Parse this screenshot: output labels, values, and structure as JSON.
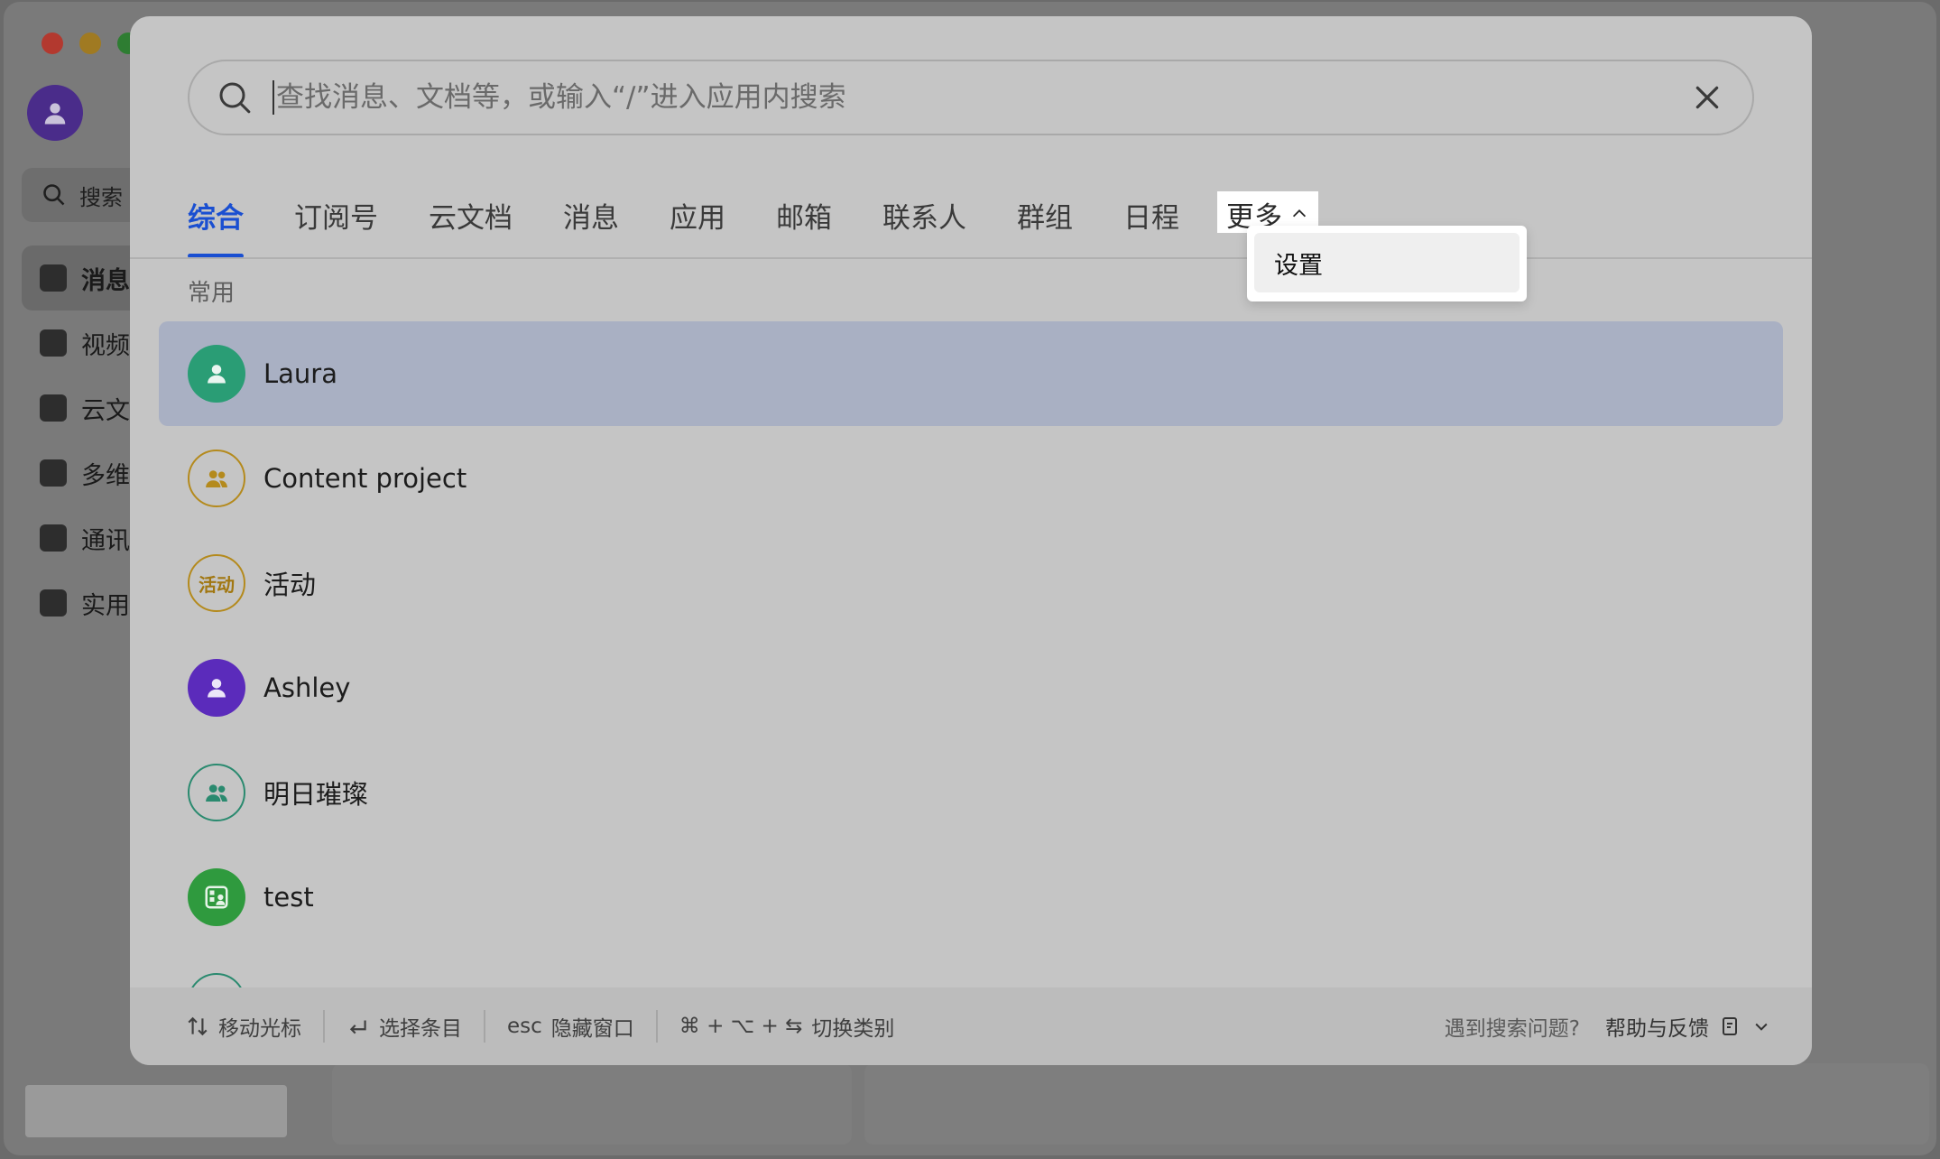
{
  "background": {
    "search_label": "搜索",
    "nav_items": [
      {
        "label": "消息",
        "icon": "chat-icon",
        "active": true
      },
      {
        "label": "视频",
        "icon": "video-icon"
      },
      {
        "label": "云文",
        "icon": "docs-icon"
      },
      {
        "label": "多维",
        "icon": "table-icon"
      },
      {
        "label": "通讯",
        "icon": "contacts-icon"
      },
      {
        "label": "实用",
        "icon": "apps-icon"
      }
    ]
  },
  "search": {
    "placeholder": "查找消息、文档等，或输入“/”进入应用内搜索",
    "value": ""
  },
  "tabs": [
    {
      "label": "综合",
      "active": true
    },
    {
      "label": "订阅号"
    },
    {
      "label": "云文档"
    },
    {
      "label": "消息"
    },
    {
      "label": "应用"
    },
    {
      "label": "邮箱"
    },
    {
      "label": "联系人"
    },
    {
      "label": "群组"
    },
    {
      "label": "日程"
    }
  ],
  "more_tab": {
    "label": "更多",
    "icon": "chevron-up-icon"
  },
  "dropdown": {
    "items": [
      {
        "label": "设置"
      }
    ]
  },
  "section_label": "常用",
  "results": [
    {
      "name": "Laura",
      "avatar": "person-icon",
      "selected": true
    },
    {
      "name": "Content project",
      "avatar": "group-icon"
    },
    {
      "name": "活动",
      "avatar_text": "活动"
    },
    {
      "name": "Ashley",
      "avatar": "person-icon"
    },
    {
      "name": "明日璀璨",
      "avatar": "group-icon"
    },
    {
      "name": "test",
      "avatar": "calendar-group-icon"
    }
  ],
  "footer": {
    "move_cursor": "移动光标",
    "select_item": "选择条目",
    "esc_key": "esc",
    "hide_window": "隐藏窗口",
    "shortcut_keys": "⌘ + ⌥ + ⇆",
    "switch_category": "切换类别",
    "question": "遇到搜索问题?",
    "help": "帮助与反馈"
  },
  "colors": {
    "accent": "#1a4fd1",
    "selected_row": "#a9b0c3"
  }
}
